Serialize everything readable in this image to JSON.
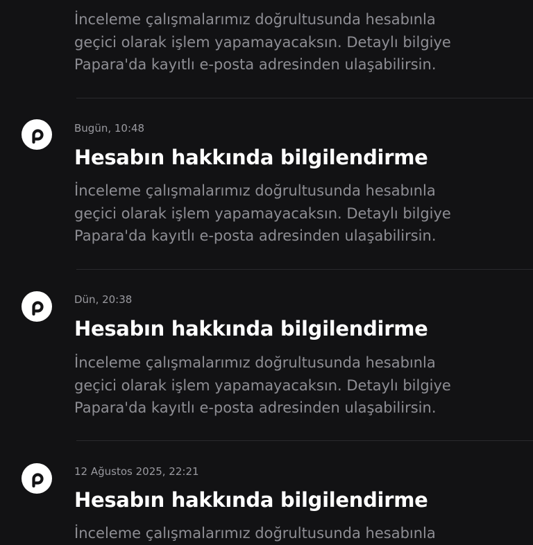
{
  "notifications": [
    {
      "timestamp": "",
      "title": "",
      "body_lines": [
        "İnceleme çalışmalarımız doğrultusunda hesabınla",
        "geçici olarak işlem yapamayacaksın. Detaylı bilgiye",
        "Papara'da kayıtlı e-posta adresinden ulaşabilirsin."
      ]
    },
    {
      "timestamp": "Bugün, 10:48",
      "title": "Hesabın hakkında bilgilendirme",
      "body_lines": [
        "İnceleme çalışmalarımız doğrultusunda hesabınla",
        "geçici olarak işlem yapamayacaksın. Detaylı bilgiye",
        "Papara'da kayıtlı e-posta adresinden ulaşabilirsin."
      ]
    },
    {
      "timestamp": "Dün, 20:38",
      "title": "Hesabın hakkında bilgilendirme",
      "body_lines": [
        "İnceleme çalışmalarımız doğrultusunda hesabınla",
        "geçici olarak işlem yapamayacaksın. Detaylı bilgiye",
        "Papara'da kayıtlı e-posta adresinden ulaşabilirsin."
      ]
    },
    {
      "timestamp": "12 Ağustos 2025, 22:21",
      "title": "Hesabın hakkında bilgilendirme",
      "body_lines": [
        "İnceleme çalışmalarımız doğrultusunda hesabınla"
      ]
    }
  ],
  "icons": {
    "app_logo": "papara-logo-icon"
  },
  "colors": {
    "background": "#121214",
    "title": "#ffffff",
    "body": "#8e8e94",
    "timestamp": "#9a9aa0",
    "avatar_bg": "#ffffff",
    "divider": "#2a2a2e"
  }
}
